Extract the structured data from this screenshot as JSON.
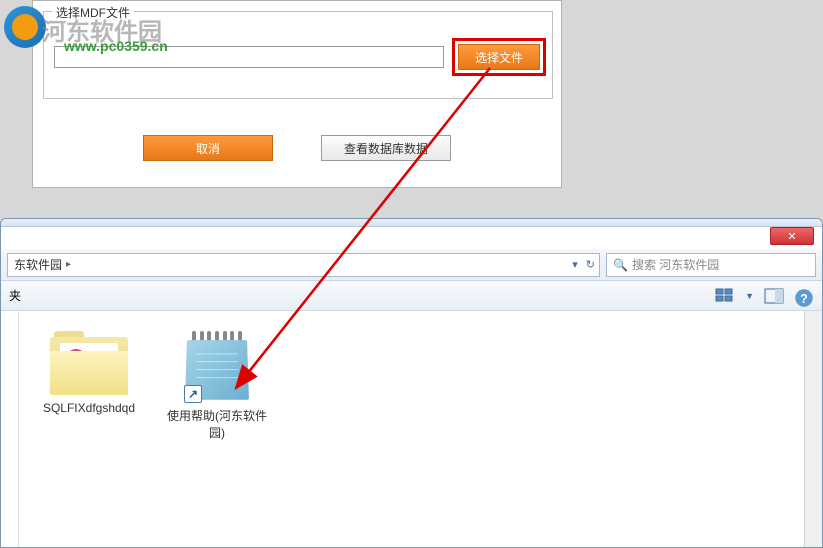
{
  "watermark": {
    "text": "河东软件园",
    "url": "www.pc0359.cn"
  },
  "dialog": {
    "group_label": "选择MDF文件",
    "select_file_btn": "选择文件",
    "cancel_btn": "取消",
    "view_db_btn": "查看数据库数据"
  },
  "explorer": {
    "close": "✕",
    "breadcrumb_current": "东软件园",
    "breadcrumb_sep": "▸",
    "refresh_down": "▾",
    "refresh_icon": "↻",
    "search_placeholder": "搜索 河东软件园",
    "toolbar_organize": "夹",
    "files": [
      {
        "name": "SQLFIXdfgshdqd",
        "type": "folder"
      },
      {
        "name": "使用帮助(河东软件园)",
        "type": "shortcut"
      }
    ]
  }
}
